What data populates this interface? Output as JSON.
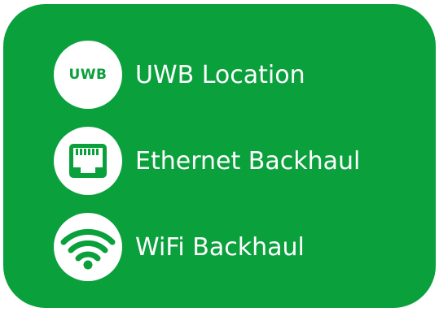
{
  "colors": {
    "background": "#ffffff",
    "card": "#0aa03c",
    "text": "#ffffff"
  },
  "items": [
    {
      "icon": "uwb-badge-icon",
      "badge_text": "UWB",
      "label": "UWB Location"
    },
    {
      "icon": "ethernet-port-icon",
      "label": "Ethernet Backhaul"
    },
    {
      "icon": "wifi-icon",
      "label": "WiFi Backhaul"
    }
  ]
}
